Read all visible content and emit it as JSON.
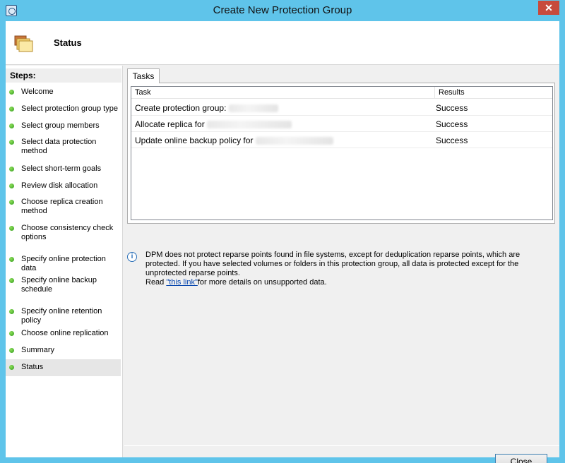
{
  "window": {
    "title": "Create New Protection Group",
    "close_glyph": "✕"
  },
  "header": {
    "title": "Status",
    "icon": "folder-stack-icon"
  },
  "steps": {
    "heading": "Steps:",
    "items": [
      {
        "label": "Welcome"
      },
      {
        "label": "Select protection group type"
      },
      {
        "label": "Select group members"
      },
      {
        "label": "Select data protection method"
      },
      {
        "label": "Select short-term goals"
      },
      {
        "label": "Review disk allocation"
      },
      {
        "label": "Choose replica creation method"
      },
      {
        "label": "Choose consistency check options"
      },
      {
        "label": "Specify online protection data"
      },
      {
        "label": "Specify online backup schedule"
      },
      {
        "label": "Specify online retention policy"
      },
      {
        "label": "Choose online replication"
      },
      {
        "label": "Summary"
      },
      {
        "label": "Status"
      }
    ],
    "current": "Status",
    "status_color": "#3aa821"
  },
  "tabs": [
    {
      "label": "Tasks"
    }
  ],
  "table": {
    "columns": [
      "Task",
      "Results"
    ],
    "rows": [
      {
        "task": "Create protection group: ",
        "result": "Success"
      },
      {
        "task": "Allocate replica for ",
        "result": "Success"
      },
      {
        "task": "Update online backup policy for ",
        "result": "Success"
      }
    ]
  },
  "info": {
    "text_main": "DPM does not protect reparse points found in file systems, except for deduplication reparse points, which are protected. If you have selected volumes or folders in this protection group, all data is protected except for the unprotected reparse points.",
    "read_prefix": "Read ",
    "link_text": "\"this link\"",
    "read_suffix": "for more details on unsupported data.",
    "icon": "info-icon"
  },
  "buttons": {
    "close": "Close"
  }
}
